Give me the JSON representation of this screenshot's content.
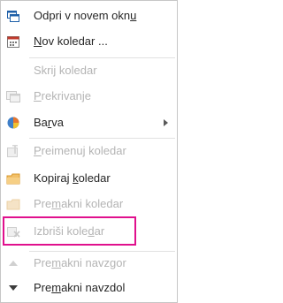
{
  "menu": {
    "items": [
      {
        "label_pre": "Odpri v novem okn",
        "label_ul": "u",
        "label_post": "",
        "icon": "open-window-icon"
      },
      {
        "label_pre": "",
        "label_ul": "N",
        "label_post": "ov koledar ...",
        "icon": "new-calendar-icon"
      },
      {
        "label_pre": "Skrij koledar",
        "label_ul": "",
        "label_post": "",
        "icon": ""
      },
      {
        "label_pre": "",
        "label_ul": "P",
        "label_post": "rekrivanje",
        "icon": "overlay-icon"
      },
      {
        "label_pre": "Ba",
        "label_ul": "r",
        "label_post": "va",
        "icon": "color-icon"
      },
      {
        "label_pre": "",
        "label_ul": "P",
        "label_post": "reimenuj koledar",
        "icon": "rename-calendar-icon"
      },
      {
        "label_pre": "Kopiraj ",
        "label_ul": "k",
        "label_post": "oledar",
        "icon": "copy-calendar-icon"
      },
      {
        "label_pre": "Pre",
        "label_ul": "m",
        "label_post": "akni koledar",
        "icon": "move-calendar-icon"
      },
      {
        "label_pre": "Izbriši kole",
        "label_ul": "d",
        "label_post": "ar",
        "icon": "delete-calendar-icon"
      },
      {
        "label_pre": "Pre",
        "label_ul": "m",
        "label_post": "akni navzgor",
        "icon": "move-up-icon"
      },
      {
        "label_pre": "Pre",
        "label_ul": "m",
        "label_post": "akni navzdol",
        "icon": "move-down-icon"
      }
    ]
  },
  "colors": {
    "highlight": "#e0108d",
    "disabled_text": "#b4b4b4",
    "text": "#262626"
  }
}
